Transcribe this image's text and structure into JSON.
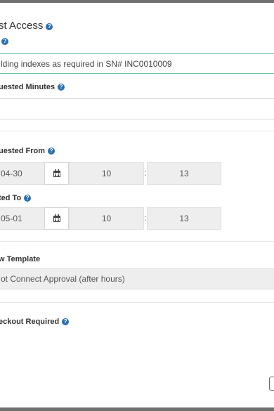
{
  "dialog": {
    "title": "st Access",
    "labels": {
      "reason": "",
      "requested_minutes": "uested Minutes",
      "requested_from": "uested From",
      "requested_to": "ted To",
      "workflow_template": "w Template",
      "checkout_required": "eckout Required"
    },
    "fields": {
      "reason_value": "lding indexes as required in SN# INC0010009",
      "requested_minutes_value": "",
      "from_date": "04-30",
      "from_hour": "10",
      "from_minute": "13",
      "to_date": "05-01",
      "to_hour": "10",
      "to_minute": "13",
      "template_value": "ot Connect Approval (after hours)",
      "time_separator": ":"
    },
    "icons": {
      "help": "question-circle-icon",
      "calendar": "calendar-icon"
    },
    "colors": {
      "accent_border": "#6cc2b4",
      "help_icon": "#2a6fb0"
    }
  }
}
